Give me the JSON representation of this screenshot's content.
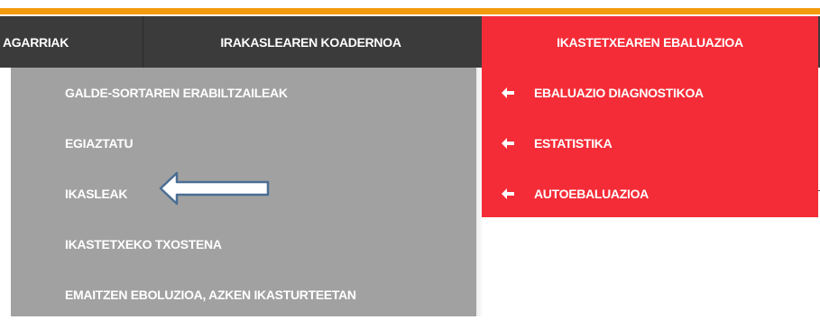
{
  "navbar": {
    "items": [
      {
        "label": "AGARRIAK"
      },
      {
        "label": "IRAKASLEAREN KOADERNOA"
      },
      {
        "label": "IKASTETXEAREN EBALUAZIOA",
        "active": true
      }
    ]
  },
  "submenu_left": {
    "items": [
      {
        "label": "GALDE-SORTAREN ERABILTZAILEAK"
      },
      {
        "label": "EGIAZTATU"
      },
      {
        "label": "IKASLEAK"
      },
      {
        "label": "IKASTETXEKO TXOSTENA"
      },
      {
        "label": "EMAITZEN EBOLUZIOA, AZKEN IKASTURTEETAN"
      }
    ]
  },
  "submenu_right": {
    "items": [
      {
        "label": "EBALUAZIO DIAGNOSTIKOA",
        "icon": "arrow-left-icon"
      },
      {
        "label": "ESTATISTIKA",
        "icon": "arrow-left-icon"
      },
      {
        "label": "AUTOEBALUAZIOA",
        "icon": "arrow-left-icon"
      }
    ]
  },
  "colors": {
    "accent_bar": "#f39a0e",
    "navbar_bg": "#3b3b3b",
    "active_red": "#f42c37",
    "submenu_gray": "#a1a1a1",
    "pointer_arrow_stroke": "#4a6e94"
  }
}
